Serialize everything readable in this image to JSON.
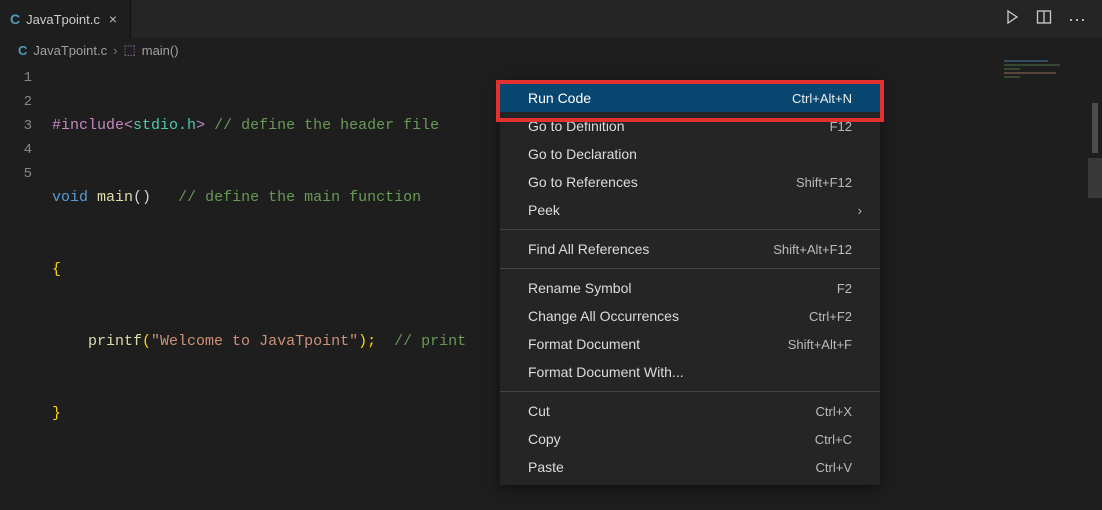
{
  "tab": {
    "filename": "JavaTpoint.c"
  },
  "breadcrumb": {
    "file": "JavaTpoint.c",
    "symbol": "main()"
  },
  "code": {
    "l1": {
      "pp": "#include",
      "lt": "<",
      "path": "stdio.h",
      "gt": ">",
      "cmt": " // define the header file"
    },
    "l2": {
      "kw1": "void",
      "fn": " main",
      "par": "()",
      "sp": "   ",
      "cmt": "// define the main function"
    },
    "l3": {
      "br": "{"
    },
    "l4": {
      "indent": "    ",
      "fn": "printf",
      "op": "(",
      "str": "\"Welcome to JavaTpoint\"",
      "cp": ");",
      "sp": "  ",
      "cmt": "// print"
    },
    "l5": {
      "br": "}"
    }
  },
  "lines": [
    "1",
    "2",
    "3",
    "4",
    "5"
  ],
  "menu": {
    "runCode": {
      "label": "Run Code",
      "shortcut": "Ctrl+Alt+N"
    },
    "goDef": {
      "label": "Go to Definition",
      "shortcut": "F12"
    },
    "goDecl": {
      "label": "Go to Declaration",
      "shortcut": ""
    },
    "goRef": {
      "label": "Go to References",
      "shortcut": "Shift+F12"
    },
    "peek": {
      "label": "Peek"
    },
    "findAll": {
      "label": "Find All References",
      "shortcut": "Shift+Alt+F12"
    },
    "rename": {
      "label": "Rename Symbol",
      "shortcut": "F2"
    },
    "changeAll": {
      "label": "Change All Occurrences",
      "shortcut": "Ctrl+F2"
    },
    "fmtDoc": {
      "label": "Format Document",
      "shortcut": "Shift+Alt+F"
    },
    "fmtWith": {
      "label": "Format Document With..."
    },
    "cut": {
      "label": "Cut",
      "shortcut": "Ctrl+X"
    },
    "copy": {
      "label": "Copy",
      "shortcut": "Ctrl+C"
    },
    "paste": {
      "label": "Paste",
      "shortcut": "Ctrl+V"
    }
  }
}
